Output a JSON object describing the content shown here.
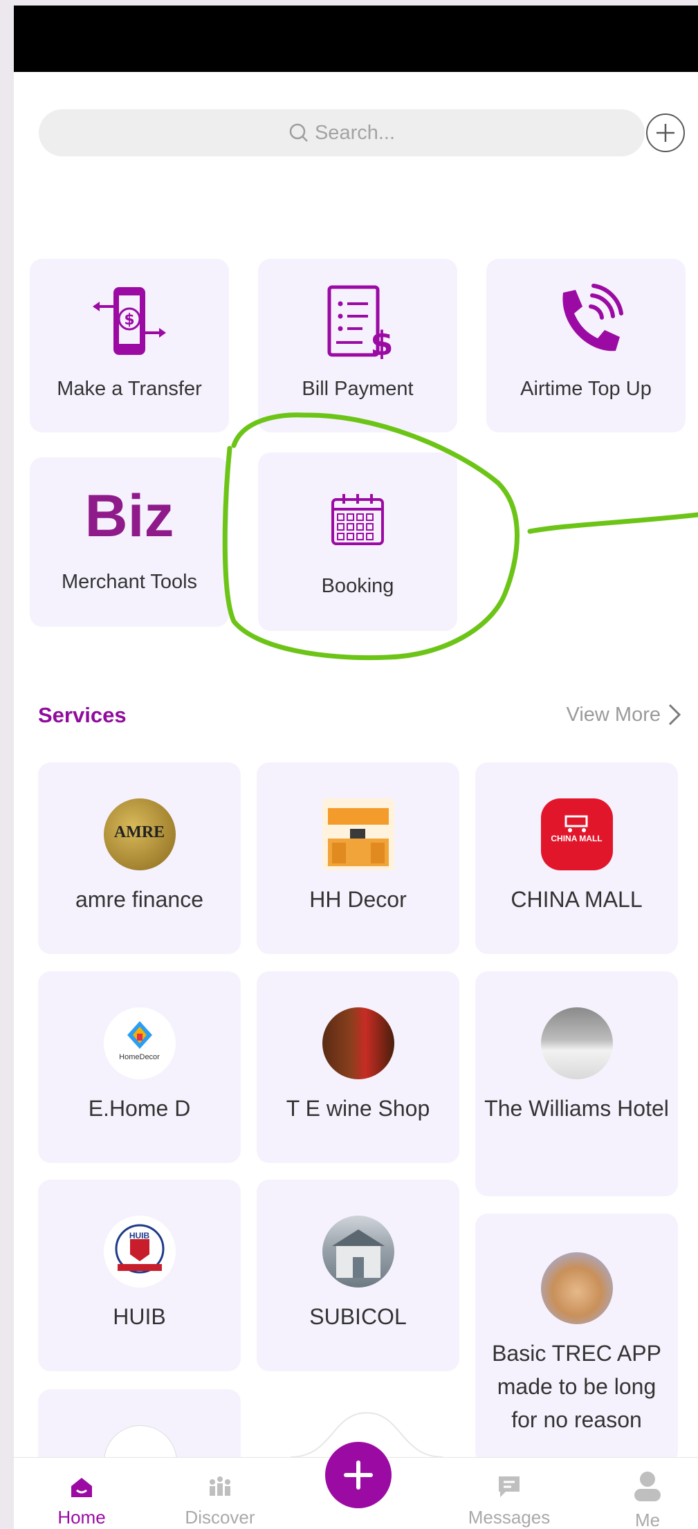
{
  "search": {
    "placeholder": "Search..."
  },
  "quick_actions": [
    {
      "label": "Make a Transfer",
      "icon": "phone-transfer-icon"
    },
    {
      "label": "Bill Payment",
      "icon": "bill-icon"
    },
    {
      "label": "Airtime Top Up",
      "icon": "phone-call-icon"
    },
    {
      "label": "Merchant Tools",
      "icon": "biz-logo",
      "logo_text": "Biz"
    },
    {
      "label": "Booking",
      "icon": "calendar-icon"
    }
  ],
  "services": {
    "title": "Services",
    "view_more": "View More",
    "items": [
      {
        "name": "amre finance",
        "logo_text": "AMRE"
      },
      {
        "name": "HH Decor"
      },
      {
        "name": "CHINA MALL",
        "logo_text": "CHINA MALL"
      },
      {
        "name": "E.Home D",
        "logo_text": "HomeDecor"
      },
      {
        "name": "T E wine Shop"
      },
      {
        "name": "The Williams Hotel"
      },
      {
        "name": "HUIB",
        "logo_text": "HUIB"
      },
      {
        "name": "SUBICOL"
      },
      {
        "name": "Basic TREC APP made to be long for no reason"
      }
    ]
  },
  "bottom_nav": {
    "home": "Home",
    "discover": "Discover",
    "messages": "Messages",
    "me": "Me"
  },
  "colors": {
    "accent": "#9b0ba3",
    "tile_bg": "#f5f2fd",
    "annotation": "#6cc417"
  }
}
